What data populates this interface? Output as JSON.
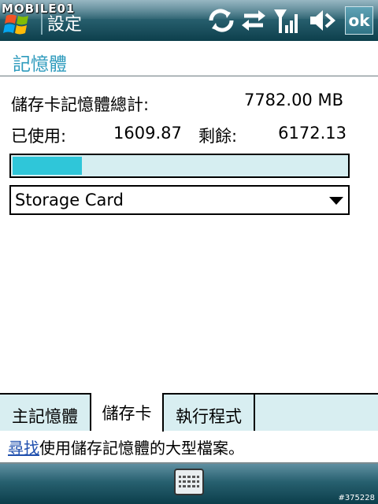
{
  "titlebar": {
    "title": "設定",
    "watermark": "MOBILE01",
    "ok_label": "ok"
  },
  "page": {
    "title": "記憶體"
  },
  "storage": {
    "total_label": "儲存卡記憶體總計:",
    "total_value": "7782.00 MB",
    "used_label": "已使用:",
    "used_value": "1609.87",
    "free_label": "剩餘:",
    "free_value": "6172.13",
    "used_fraction": 0.2069
  },
  "select": {
    "selected": "Storage Card"
  },
  "tabs": [
    {
      "label": "主記憶體",
      "active": false
    },
    {
      "label": "儲存卡",
      "active": true
    },
    {
      "label": "執行程式",
      "active": false
    }
  ],
  "hint": {
    "link": "尋找",
    "text": "使用儲存記憶體的大型檔案。"
  },
  "footer": {
    "image_id": "#375228"
  },
  "colors": {
    "accent": "#2e9bbd",
    "progress_fill": "#2fc6d9",
    "progress_track": "#d6eef1",
    "tab_strip": "#d8eef1",
    "bar_dark": "#0d3f4c",
    "link": "#1f4fae"
  },
  "icons": [
    "windows-start-icon",
    "sync-icon",
    "data-transfer-icon",
    "signal-icon",
    "speaker-icon",
    "keyboard-icon"
  ]
}
